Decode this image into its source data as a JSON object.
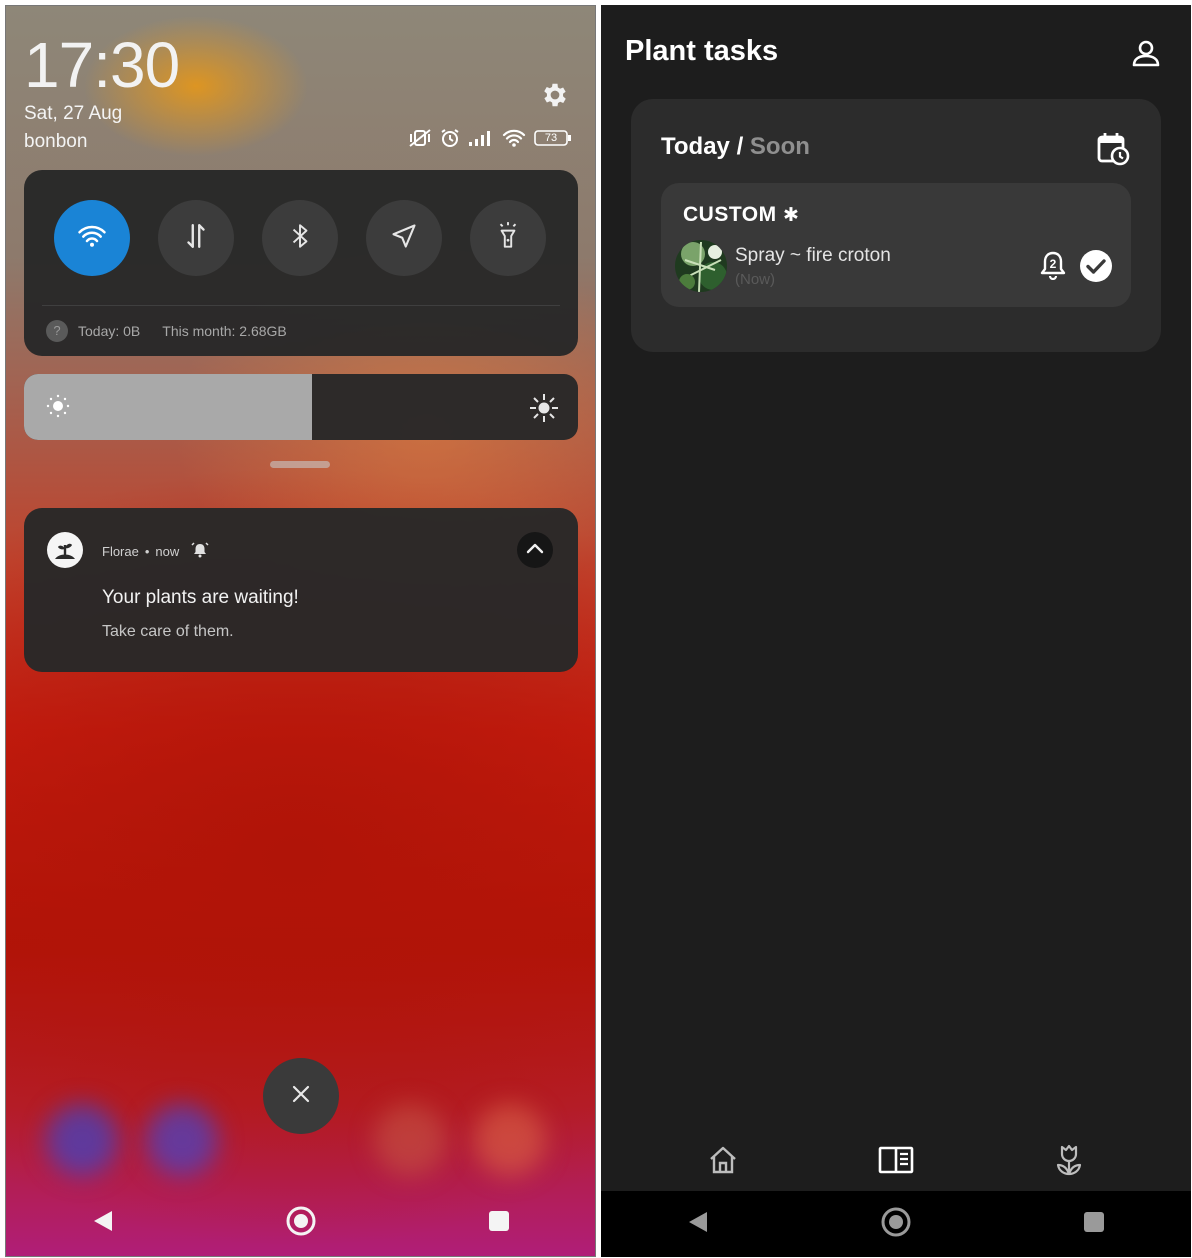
{
  "notification_shade": {
    "time": "17:30",
    "date": "Sat, 27 Aug",
    "carrier": "bonbon",
    "battery_level": "73",
    "quick_settings": {
      "tiles": [
        {
          "icon": "wifi-icon",
          "active": true
        },
        {
          "icon": "mobile-data-icon",
          "active": false
        },
        {
          "icon": "bluetooth-icon",
          "active": false
        },
        {
          "icon": "location-icon",
          "active": false
        },
        {
          "icon": "flashlight-icon",
          "active": false
        }
      ],
      "usage_icon": "?",
      "usage_today": "Today: 0B",
      "usage_month": "This month: 2.68GB"
    },
    "brightness_level_percent": 52,
    "notification": {
      "app_name": "Florae",
      "separator": "•",
      "time": "now",
      "title": "Your plants are waiting!",
      "body": "Take care of them."
    }
  },
  "plant_app": {
    "title": "Plant tasks",
    "section": {
      "title_today": "Today /",
      "title_soon": "Soon"
    },
    "group": {
      "title": "CUSTOM",
      "title_symbol": "✱",
      "task_label": "Spray ~ fire croton",
      "task_time": "(Now)",
      "reminder_count": "2"
    },
    "bottom_nav": [
      {
        "icon": "home-icon"
      },
      {
        "icon": "journal-icon"
      },
      {
        "icon": "plant-icon"
      }
    ]
  },
  "colors": {
    "accent_blue": "#1a84d6",
    "app_background": "#1d1d1d",
    "card_background": "#2c2c2c"
  }
}
